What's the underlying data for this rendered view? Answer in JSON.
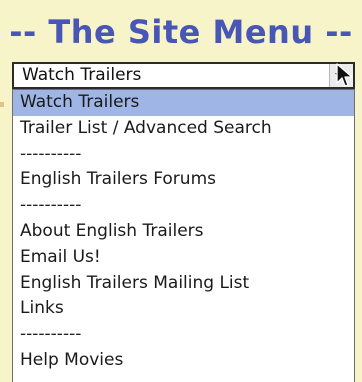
{
  "menu": {
    "title": "-- The Site Menu --",
    "select_value": "Watch Trailers",
    "options": [
      {
        "label": "Watch Trailers",
        "selected": true
      },
      {
        "label": "Trailer List / Advanced Search",
        "selected": false
      },
      {
        "label": "----------",
        "selected": false
      },
      {
        "label": "English Trailers Forums",
        "selected": false
      },
      {
        "label": "----------",
        "selected": false
      },
      {
        "label": "About English Trailers",
        "selected": false
      },
      {
        "label": "Email Us!",
        "selected": false
      },
      {
        "label": "English Trailers Mailing List",
        "selected": false
      },
      {
        "label": "Links",
        "selected": false
      },
      {
        "label": "----------",
        "selected": false
      },
      {
        "label": "Help Movies",
        "selected": false
      }
    ]
  },
  "colors": {
    "background": "#f7f4ca",
    "title": "#4856b6",
    "selected_highlight": "#9fb5e6"
  },
  "icons": [
    "dropdown-arrow-icon",
    "mouse-cursor-icon"
  ]
}
